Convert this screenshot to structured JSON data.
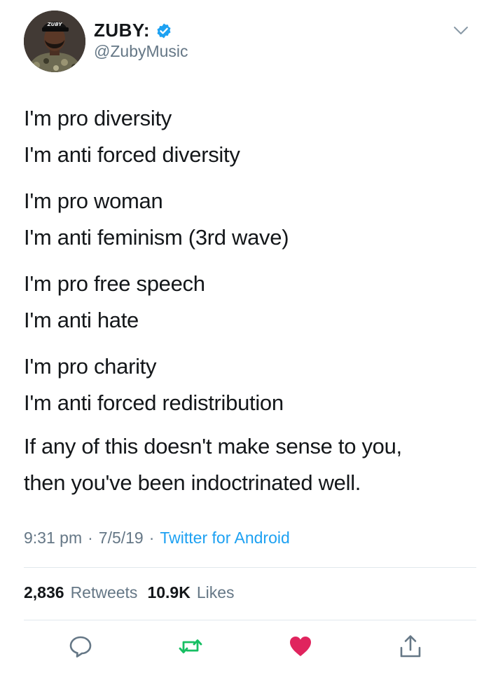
{
  "author": {
    "display_name": "ZUBY:",
    "handle": "@ZubyMusic",
    "verified": true,
    "avatar_cap_text": "ZUBY"
  },
  "tweet": {
    "paragraphs": [
      [
        "I'm pro diversity",
        "I'm anti forced diversity"
      ],
      [
        "I'm pro woman",
        "I'm anti feminism (3rd wave)"
      ],
      [
        "I'm pro free speech",
        "I'm anti hate"
      ],
      [
        "I'm pro charity",
        "I'm anti forced redistribution"
      ],
      [
        "If any of this doesn't make sense to you,",
        "then you've been indoctrinated well."
      ]
    ]
  },
  "meta": {
    "time": "9:31 pm",
    "separator": "·",
    "date": "7/5/19",
    "source": "Twitter for Android"
  },
  "stats": {
    "retweets_count": "2,836",
    "retweets_label": "Retweets",
    "likes_count": "10.9K",
    "likes_label": "Likes"
  },
  "icons": {
    "reply": "reply-icon",
    "retweet": "retweet-icon",
    "like": "heart-icon",
    "share": "share-icon",
    "menu": "chevron-down-icon",
    "verified": "verified-badge-icon"
  },
  "colors": {
    "text": "#14171a",
    "secondary": "#657786",
    "link": "#1da1f2",
    "verified": "#1da1f2",
    "retweet_green": "#17bf63",
    "like_red": "#e0245e",
    "divider": "#e1e8ed"
  }
}
